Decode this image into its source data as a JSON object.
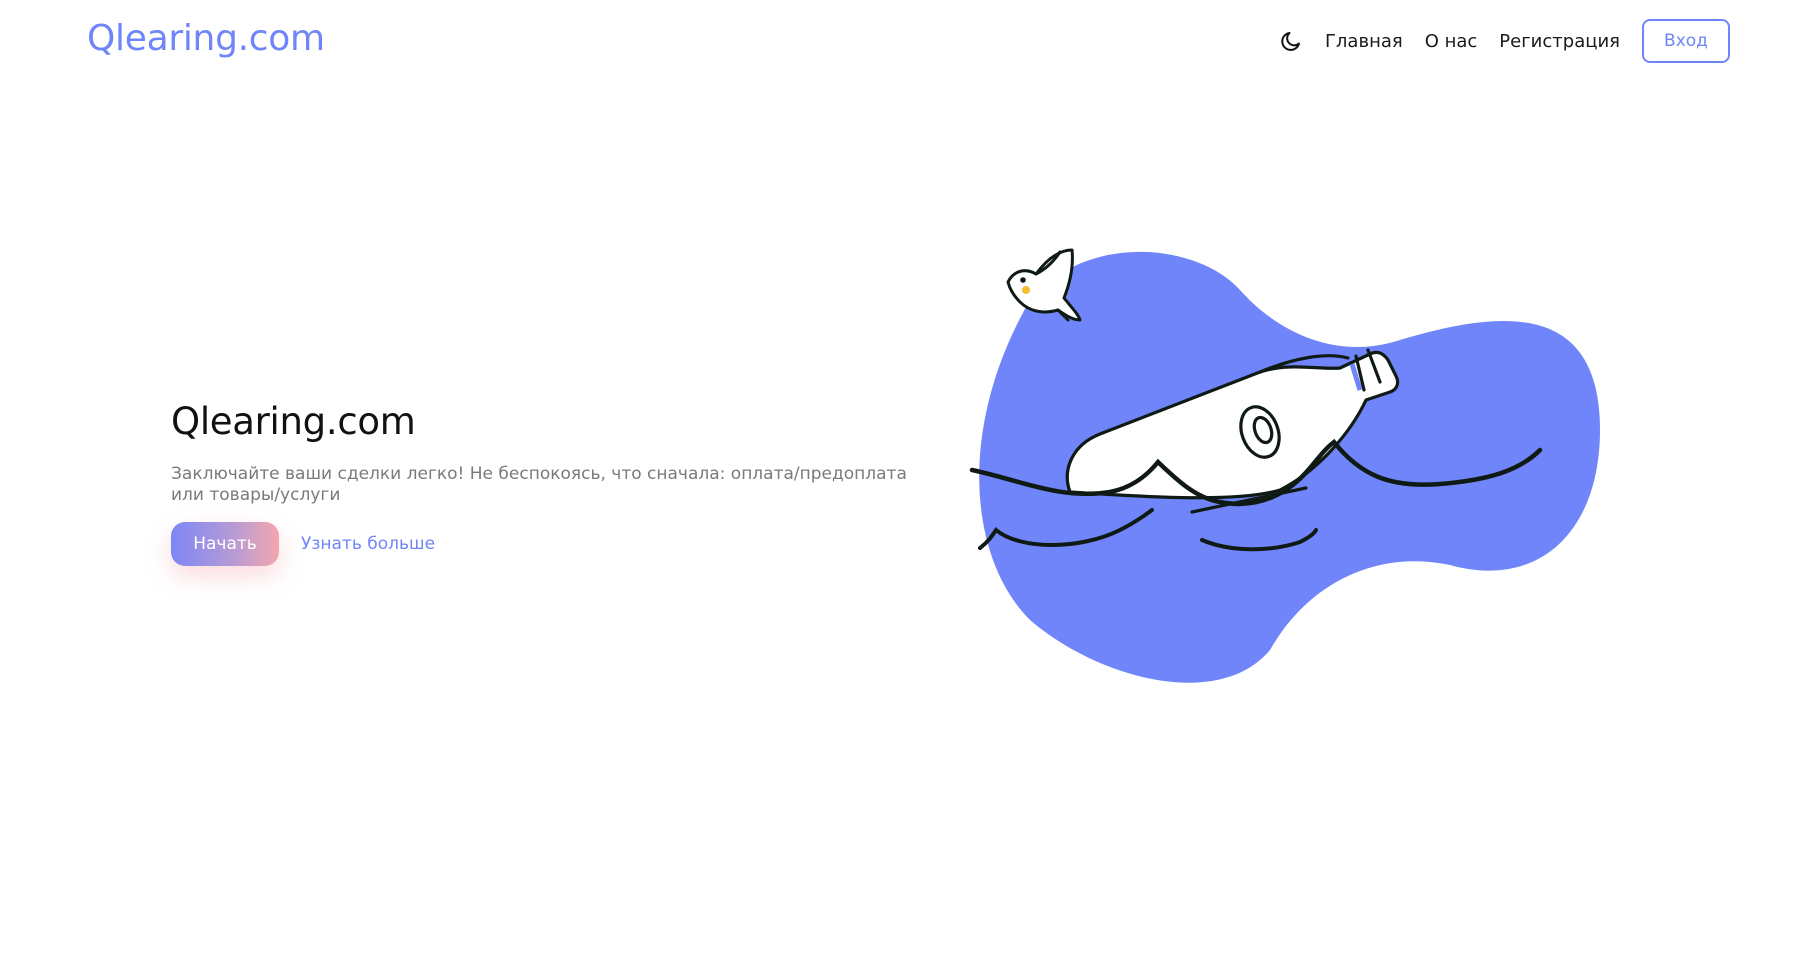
{
  "header": {
    "logo": "Qlearing.com",
    "theme_toggle_icon": "moon-icon",
    "nav": [
      {
        "label": "Главная"
      },
      {
        "label": "О нас"
      },
      {
        "label": "Регистрация"
      }
    ],
    "login_label": "Вход"
  },
  "hero": {
    "title": "Qlearing.com",
    "description": "Заключайте ваши сделки легко! Не беспокоясь, что сначала: оплата/предоплата или товары/услуги",
    "start_label": "Начать",
    "learn_more_label": "Узнать больше"
  },
  "colors": {
    "accent": "#6f85f9",
    "blob": "#6f85f9",
    "gradient_start": "#7d86f6",
    "gradient_end": "#f4a6ad"
  }
}
